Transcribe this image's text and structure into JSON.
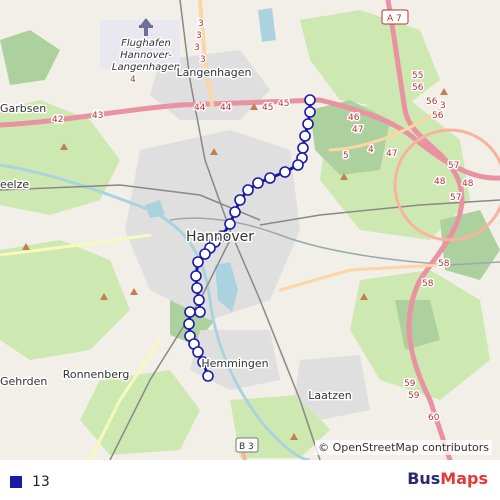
{
  "map": {
    "places": {
      "airport": "Flughafen Hannover-Langenhagen",
      "airport_l1": "Flughafen",
      "airport_l2": "Hannover-",
      "airport_l3": "Langenhagen",
      "langenhagen": "Langenhagen",
      "garbsen": "Garbsen",
      "seelze": "eelze",
      "hannover": "Hannover",
      "ronnenberg": "Ronnenberg",
      "gehrden": "Gehrden",
      "hemmingen": "Hemmingen",
      "laatzen": "Laatzen"
    },
    "road_labels": {
      "a7": "A 7",
      "b3": "B 3",
      "r3a": "3",
      "r3b": "3",
      "r3c": "3",
      "r3d": "3",
      "r4a": "4",
      "r4b": "4",
      "r5": "5",
      "r42": "42",
      "r43": "43",
      "r44a": "44",
      "r44b": "44",
      "r45a": "45",
      "r45b": "45",
      "r46": "46",
      "r47a": "47",
      "r47b": "47",
      "r48a": "48",
      "r48b": "48",
      "r55": "55",
      "r56a": "56",
      "r56b": "56",
      "r56c": "56",
      "r3e": "3",
      "r57a": "57",
      "r57b": "57",
      "r58a": "58",
      "r58b": "58",
      "r59a": "59",
      "r59b": "59",
      "r60": "60"
    },
    "attribution": "© OpenStreetMap contributors",
    "route": {
      "name": "13",
      "color": "#1a1aa6",
      "stop_count": 31
    }
  },
  "footer": {
    "legend_label": "13",
    "legend_color": "#1a1aa6",
    "brand_part1": "Bus",
    "brand_part2": "Maps"
  }
}
